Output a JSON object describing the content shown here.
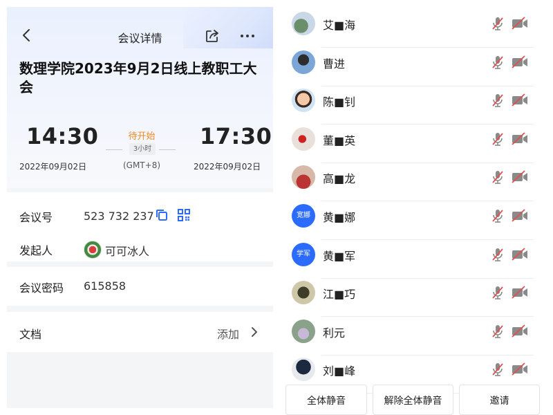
{
  "nav": {
    "title": "会议详情"
  },
  "meeting": {
    "title": "数理学院2023年9月2日线上教职工大会",
    "start_time": "14:30",
    "end_time": "17:30",
    "start_date": "2022年09月02日",
    "end_date": "2022年09月02日",
    "status": "待开始",
    "duration": "3小时",
    "timezone": "(GMT+8)"
  },
  "info": {
    "id_label": "会议号",
    "id_value": "523 732 237",
    "host_label": "发起人",
    "host_name": "可可冰人",
    "password_label": "会议密码",
    "password_value": "615858",
    "doc_label": "文档",
    "doc_action": "添加"
  },
  "participants": [
    {
      "name": "艾■海",
      "avatar_text": ""
    },
    {
      "name": "曹进",
      "avatar_text": ""
    },
    {
      "name": "陈■钊",
      "avatar_text": ""
    },
    {
      "name": "董■英",
      "avatar_text": ""
    },
    {
      "name": "高■龙",
      "avatar_text": ""
    },
    {
      "name": "黄■娜",
      "avatar_text": "宽娜"
    },
    {
      "name": "黄■军",
      "avatar_text": "学军"
    },
    {
      "name": "江■巧",
      "avatar_text": ""
    },
    {
      "name": "利元",
      "avatar_text": ""
    },
    {
      "name": "刘■峰",
      "avatar_text": ""
    }
  ],
  "actions": {
    "mute_all": "全体静音",
    "unmute_all": "解除全体静音",
    "invite": "邀请"
  },
  "colors": {
    "accent": "#2b6bff",
    "status": "#f08a24",
    "muted_red": "#e05050"
  }
}
